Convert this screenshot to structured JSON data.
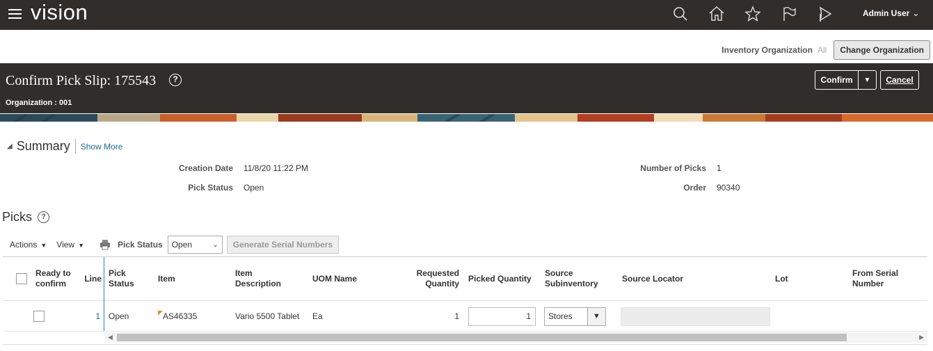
{
  "app": {
    "brand": "vision",
    "user": "Admin User"
  },
  "org_bar": {
    "label": "Inventory Organization",
    "value": "All",
    "change_button": "Change Organization"
  },
  "page": {
    "title": "Confirm Pick Slip: 175543",
    "organization": "Organization : 001",
    "confirm_label": "Confirm",
    "cancel_label": "Cancel"
  },
  "summary": {
    "heading": "Summary",
    "show_more": "Show More",
    "creation_date_label": "Creation Date",
    "creation_date": "11/8/20 11:22 PM",
    "pick_status_label": "Pick Status",
    "pick_status": "Open",
    "num_picks_label": "Number of Picks",
    "num_picks": "1",
    "order_label": "Order",
    "order": "90340"
  },
  "picks": {
    "heading": "Picks",
    "actions_label": "Actions",
    "view_label": "View",
    "pick_status_label": "Pick Status",
    "pick_status_value": "Open",
    "generate_label": "Generate Serial Numbers",
    "columns": {
      "ready_to_confirm": "Ready to confirm",
      "line": "Line",
      "pick_status": "Pick Status",
      "item": "Item",
      "item_description": "Item Description",
      "uom_name": "UOM Name",
      "requested_quantity": "Requested Quantity",
      "picked_quantity": "Picked Quantity",
      "source_subinventory": "Source Subinventory",
      "source_locator": "Source Locator",
      "lot": "Lot",
      "from_serial_number": "From Serial Number"
    },
    "rows": [
      {
        "line": "1",
        "pick_status": "Open",
        "item": "AS46335",
        "item_description": "Vario 5500 Tablet",
        "uom_name": "Ea",
        "requested_quantity": "1",
        "picked_quantity": "1",
        "source_subinventory": "Stores",
        "source_locator": "",
        "lot": "",
        "from_serial_number": ""
      }
    ]
  },
  "colors": {
    "header_bg": "#312d2a",
    "link": "#1a6a9b",
    "frozen_line": "#2c7fb8"
  }
}
